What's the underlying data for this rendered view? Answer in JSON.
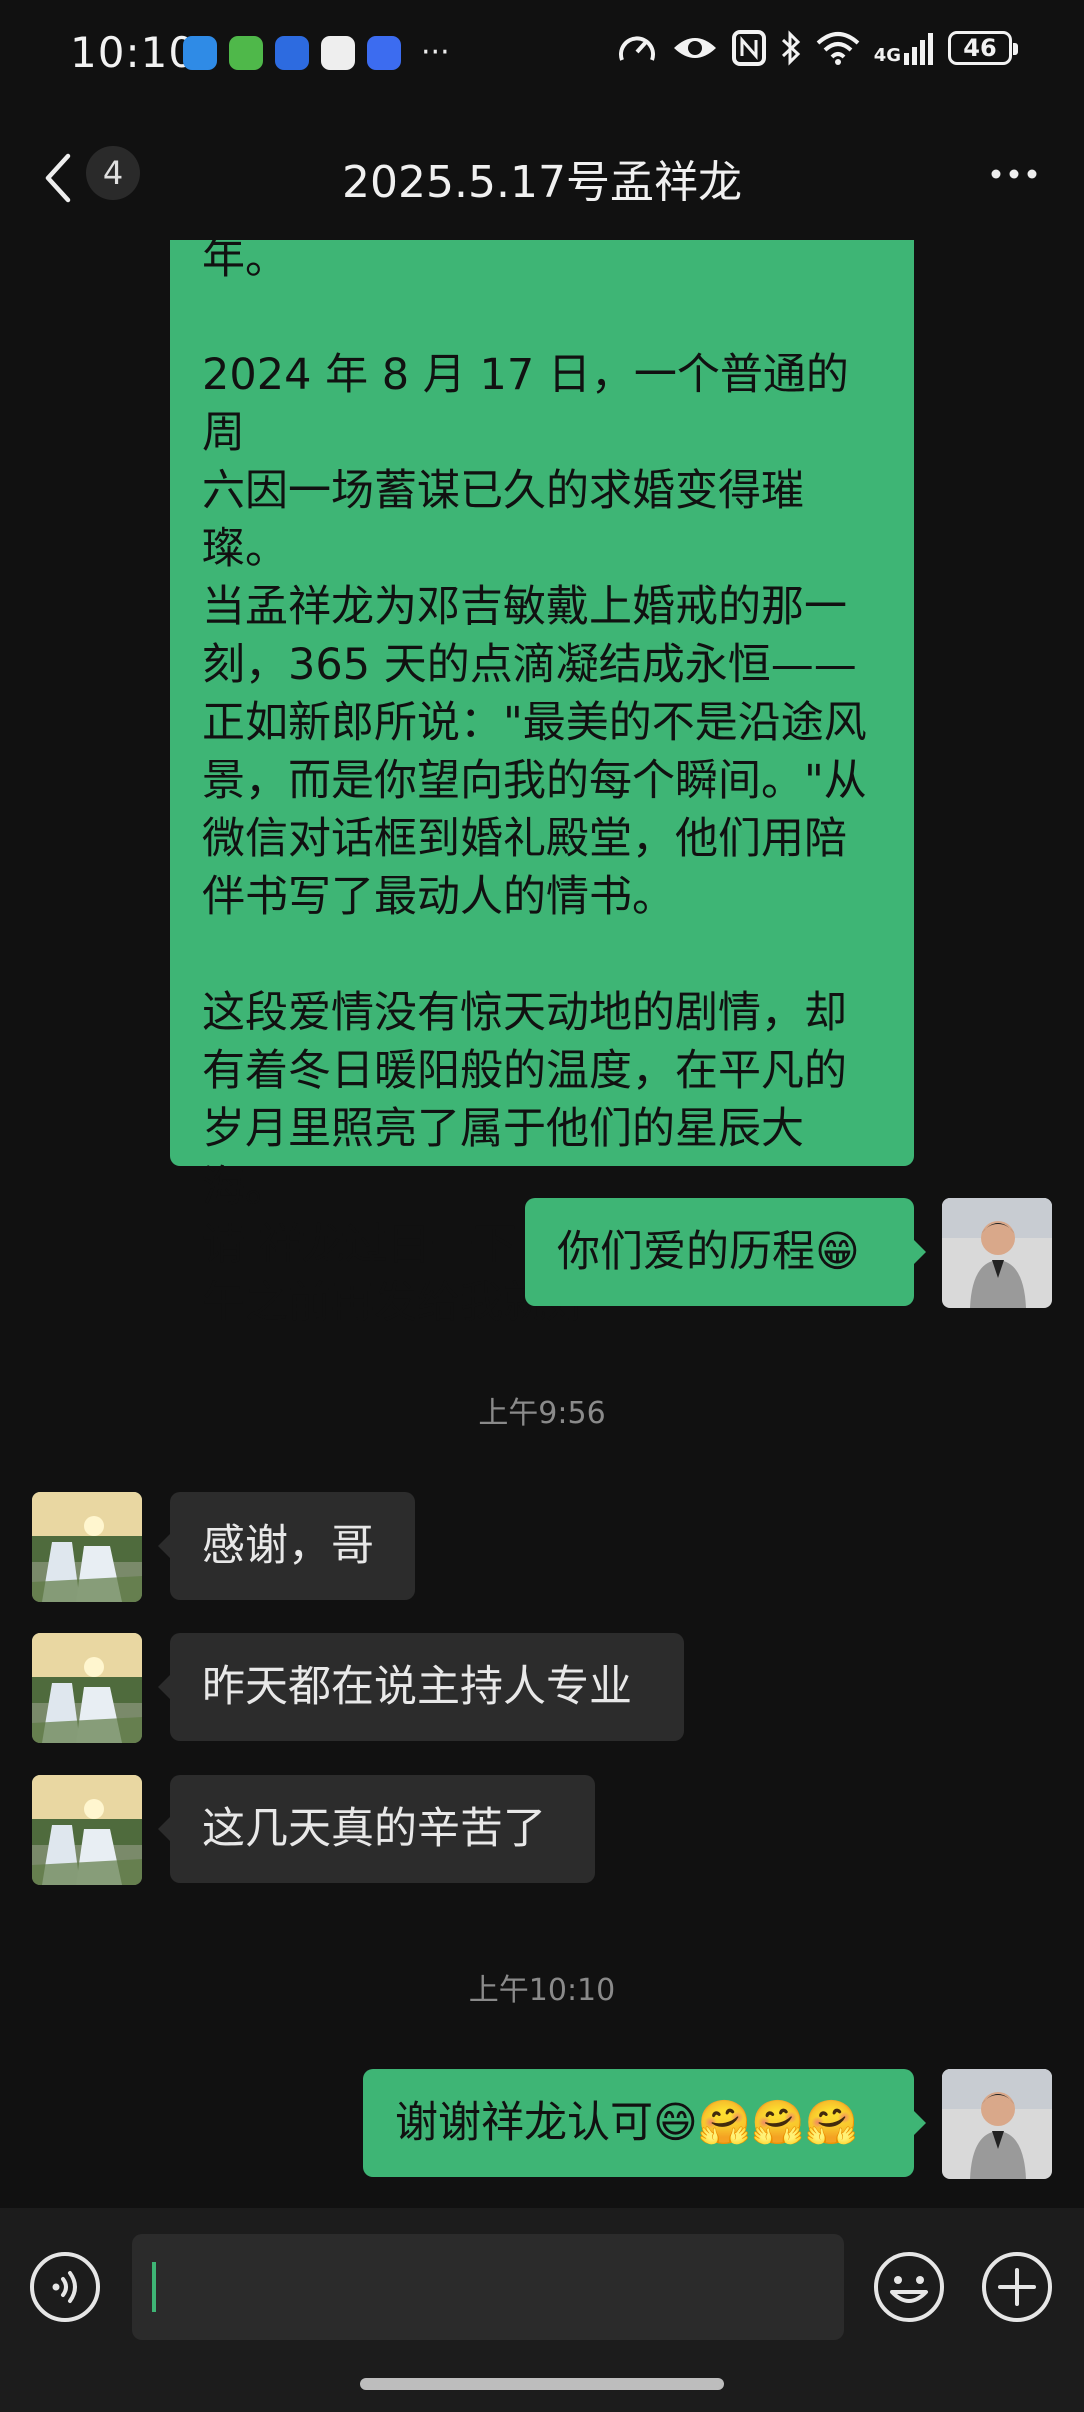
{
  "status_bar": {
    "time": "10:10",
    "more": "···",
    "network": "4G",
    "battery": "46"
  },
  "header": {
    "unread_count": "4",
    "title": "2025.5.17号孟祥龙"
  },
  "messages": {
    "long_text": "2024 年 8 月 17 日，一个普通的周\n六因一场蓄谋已久的求婚变得璀璨。\n当孟祥龙为邓吉敏戴上婚戒的那一\n刻，365 天的点滴凝结成永恒——\n正如新郎所说：\"最美的不是沿途风\n景，而是你望向我的每个瞬间。\"从\n微信对话框到婚礼殿堂，他们用陪\n伴书写了最动人的情书。\n\n这段爱情没有惊天动地的剧情，却\n有着冬日暖阳般的温度，在平凡的\n岁月里照亮了属于他们的星辰大海。\n请 祥龙过目一下  修改一下 明天中\n午之前再发给我就好",
    "top_cut_text": "年。",
    "me_1": "你们爱的历程😁",
    "time_1": "上午9:56",
    "other_1": "感谢，哥",
    "other_2": "昨天都在说主持人专业",
    "other_3": "这几天真的辛苦了",
    "time_2": "上午10:10",
    "me_2": "谢谢祥龙认可😄🤗🤗🤗"
  },
  "colors": {
    "background": "#111111",
    "my_bubble": "#3eb575",
    "other_bubble": "#2c2c2c",
    "input_bar": "#1c1c1c"
  }
}
